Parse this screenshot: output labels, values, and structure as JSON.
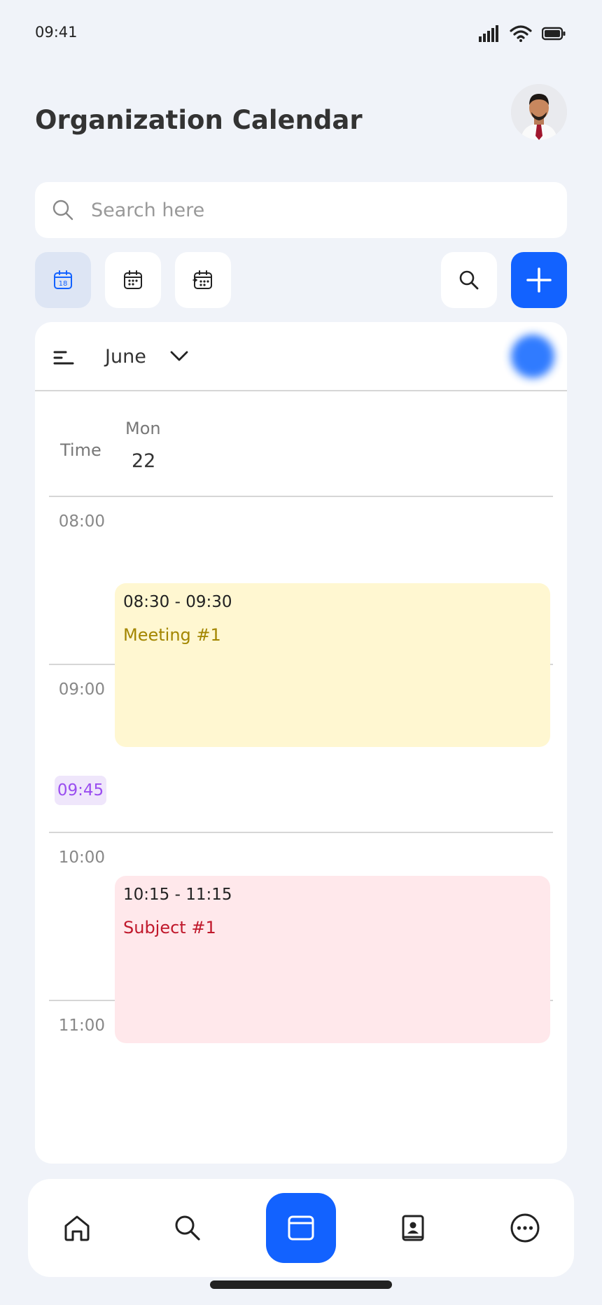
{
  "status_bar": {
    "time": "09:41"
  },
  "header": {
    "title": "Organization Calendar"
  },
  "search": {
    "placeholder": "Search here",
    "value": ""
  },
  "calendar": {
    "month": "June",
    "time_column_label": "Time",
    "day_name": "Mon",
    "day_number": "22",
    "hours": [
      "08:00",
      "09:00",
      "10:00",
      "11:00"
    ],
    "current_time": "09:45",
    "events": [
      {
        "time": "08:30 - 09:30",
        "title": "Meeting #1",
        "bg": "#fff7d1",
        "title_color": "#a38600"
      },
      {
        "time": "10:15 - 11:15",
        "title": "Subject #1",
        "bg": "#ffe8eb",
        "title_color": "#c0182b"
      }
    ]
  },
  "colors": {
    "accent": "#1262ff",
    "now_marker": "#9a4df0"
  },
  "icons": {
    "toolbar": [
      "calendar-day-icon",
      "calendar-week-icon",
      "calendar-schedule-icon",
      "search-icon",
      "plus-icon"
    ],
    "nav": [
      "home-icon",
      "search-icon",
      "calendar-icon",
      "contacts-icon",
      "more-icon"
    ]
  }
}
